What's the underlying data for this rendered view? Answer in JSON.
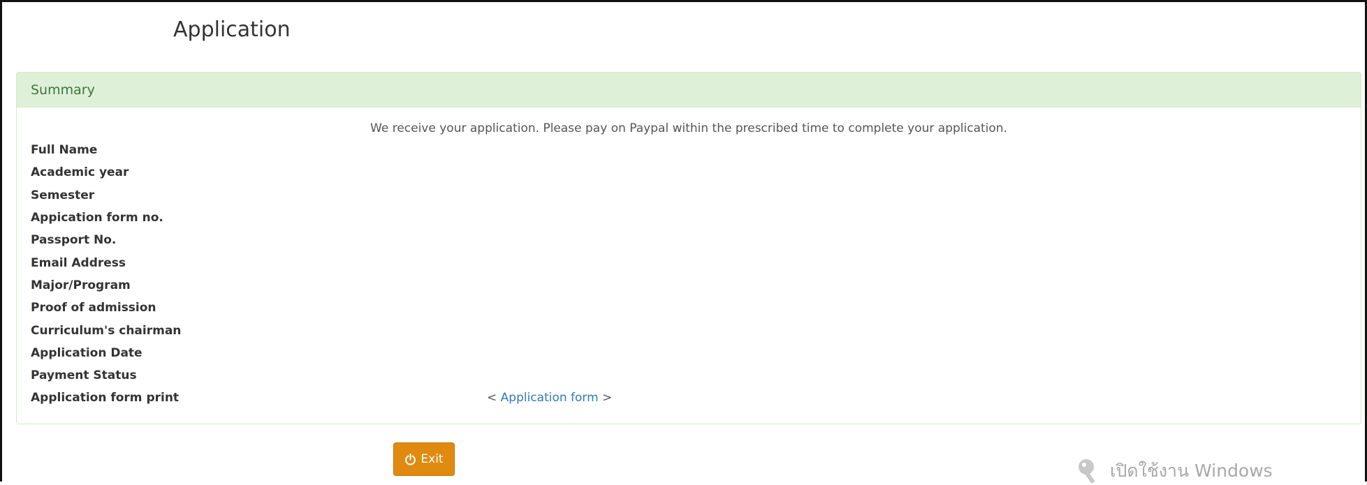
{
  "page": {
    "title": "Application"
  },
  "panel": {
    "heading": "Summary",
    "notice": "We receive your application. Please pay on Paypal within the prescribed time to complete your application."
  },
  "fields": [
    {
      "label": "Full Name",
      "value": ""
    },
    {
      "label": "Academic year",
      "value": ""
    },
    {
      "label": "Semester",
      "value": ""
    },
    {
      "label": "Appication form no.",
      "value": ""
    },
    {
      "label": "Passport No.",
      "value": ""
    },
    {
      "label": "Email Address",
      "value": ""
    },
    {
      "label": "Major/Program",
      "value": ""
    },
    {
      "label": "Proof of admission",
      "value": ""
    },
    {
      "label": "Curriculum's chairman",
      "value": ""
    },
    {
      "label": "Application Date",
      "value": ""
    },
    {
      "label": "Payment Status",
      "value": ""
    },
    {
      "label": "Application form print",
      "value": ""
    }
  ],
  "print_link": {
    "prefix": "< ",
    "label": "Application form",
    "suffix": " >"
  },
  "exit_button": {
    "label": "Exit",
    "icon": "power-icon"
  },
  "watermark": {
    "text": "เปิดใช้งาน Windows",
    "icon": "key-icon"
  },
  "colors": {
    "panel_heading_bg": "#dff0d8",
    "panel_heading_text": "#3c763d",
    "link": "#337ab7",
    "exit_button": "#e08a0f"
  }
}
